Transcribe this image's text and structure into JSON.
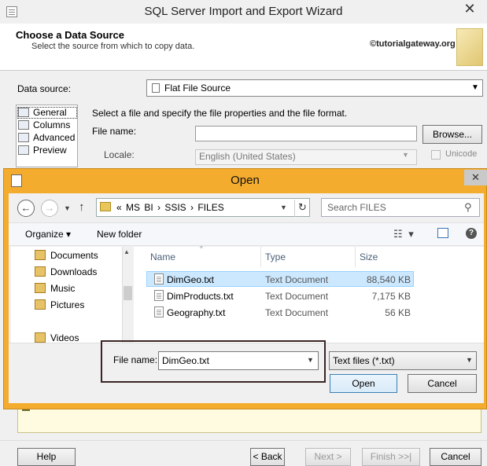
{
  "wizard": {
    "title": "SQL Server Import and Export Wizard",
    "close": "✕",
    "header_title": "Choose a Data Source",
    "header_subtitle": "Select the source from which to copy data.",
    "watermark": "©tutorialgateway.org",
    "data_source_label": "Data source:",
    "data_source_value": "Flat File Source",
    "nav_items": [
      "General",
      "Columns",
      "Advanced",
      "Preview"
    ],
    "props_description": "Select a file and specify the file properties and the file format.",
    "file_name_label": "File name:",
    "browse_label": "Browse...",
    "locale_label": "Locale:",
    "locale_value": "English (United States)",
    "unicode_label": "Unicode",
    "footer": {
      "help": "Help",
      "back": "< Back",
      "next": "Next >",
      "finish": "Finish >>|",
      "cancel": "Cancel"
    }
  },
  "open_dialog": {
    "title": "Open",
    "close": "✕",
    "breadcrumb": "«  MS BI  ›  SSIS  ›  FILES",
    "search_placeholder": "Search FILES",
    "organize_label": "Organize ▾",
    "new_folder_label": "New folder",
    "tree_items": [
      "Documents",
      "Downloads",
      "Music",
      "Pictures",
      "Videos"
    ],
    "columns": {
      "name": "Name",
      "type": "Type",
      "size": "Size"
    },
    "files": [
      {
        "name": "DimGeo.txt",
        "type": "Text Document",
        "size": "88,540 KB",
        "selected": true
      },
      {
        "name": "DimProducts.txt",
        "type": "Text Document",
        "size": "7,175 KB",
        "selected": false
      },
      {
        "name": "Geography.txt",
        "type": "Text Document",
        "size": "56 KB",
        "selected": false
      }
    ],
    "file_name_label": "File name:",
    "file_name_value": "DimGeo.txt",
    "file_type_value": "Text files (*.txt)",
    "open_button": "Open",
    "cancel_button": "Cancel"
  }
}
